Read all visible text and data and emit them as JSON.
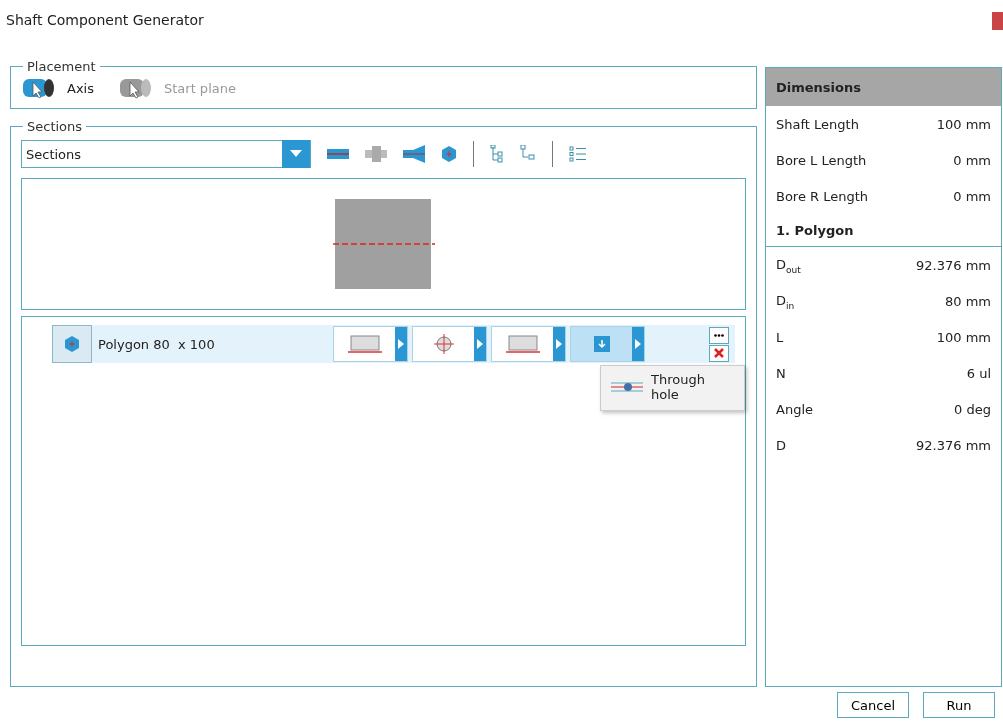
{
  "window": {
    "title": "Shaft Component Generator"
  },
  "placement": {
    "label": "Placement",
    "options": [
      {
        "label": "Axis",
        "selected": true
      },
      {
        "label": "Start plane",
        "selected": false
      }
    ]
  },
  "sections": {
    "label": "Sections",
    "combo": {
      "value": "Sections"
    },
    "row": {
      "label": "Polygon 80  x 100",
      "selected": true,
      "slots": [
        {
          "kind": "edge",
          "selected": false
        },
        {
          "kind": "cross",
          "selected": false
        },
        {
          "kind": "edge",
          "selected": false
        },
        {
          "kind": "hole",
          "selected": true
        }
      ]
    },
    "popup": {
      "label": "Through hole"
    }
  },
  "dimensions": {
    "title": "Dimensions",
    "rows": [
      {
        "kind": "row",
        "label": "Shaft Length",
        "value": "100 mm"
      },
      {
        "kind": "row",
        "label": "Bore L Length",
        "value": "0 mm"
      },
      {
        "kind": "row",
        "label": "Bore R Length",
        "value": "0 mm"
      },
      {
        "kind": "header",
        "label": "1. Polygon"
      },
      {
        "kind": "row",
        "label": "D$_{out}$",
        "value": "92.376 mm"
      },
      {
        "kind": "row",
        "label": "D$_{in}$",
        "value": "80 mm"
      },
      {
        "kind": "row",
        "label": "L",
        "value": "100 mm"
      },
      {
        "kind": "row",
        "label": "N",
        "value": "6 ul"
      },
      {
        "kind": "row",
        "label": "Angle",
        "value": "0 deg"
      },
      {
        "kind": "row",
        "label": "D",
        "value": "92.376 mm"
      }
    ]
  },
  "buttons": [
    "Cancel",
    "Run"
  ]
}
